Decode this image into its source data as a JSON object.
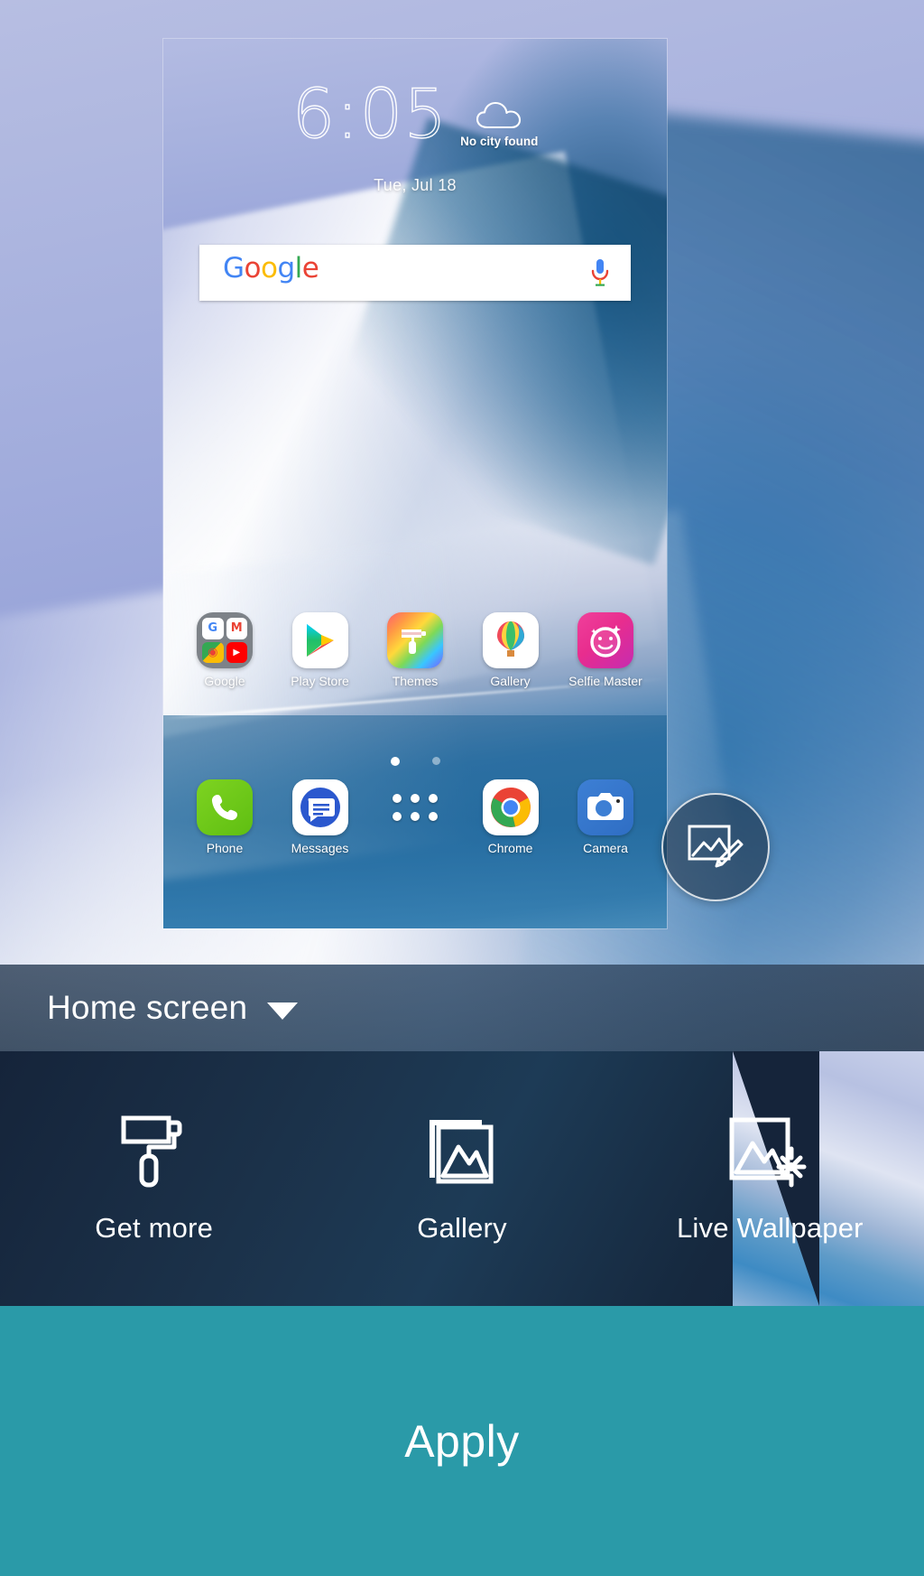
{
  "preview": {
    "clock": {
      "time": "6:05",
      "date": "Tue, Jul 18",
      "weather_city": "No city found",
      "weather_icon": "cloud-icon"
    },
    "search": {
      "logo_letters": [
        "G",
        "o",
        "o",
        "g",
        "l",
        "e"
      ],
      "mic_icon": "microphone-icon"
    },
    "apps_row1": [
      {
        "label": "Google",
        "icon": "google-folder-icon",
        "sub_icons": [
          "google-g-icon",
          "gmail-icon",
          "maps-icon",
          "youtube-icon"
        ]
      },
      {
        "label": "Play Store",
        "icon": "play-store-icon"
      },
      {
        "label": "Themes",
        "icon": "themes-paint-roller-icon"
      },
      {
        "label": "Gallery",
        "icon": "gallery-balloon-icon"
      },
      {
        "label": "Selfie Master",
        "icon": "selfie-master-icon"
      }
    ],
    "page_indicator": {
      "count": 2,
      "active_index": 0
    },
    "dock": [
      {
        "label": "Phone",
        "icon": "phone-handset-icon"
      },
      {
        "label": "Messages",
        "icon": "messages-bubble-icon"
      },
      {
        "label": "",
        "icon": "app-drawer-grid-icon"
      },
      {
        "label": "Chrome",
        "icon": "chrome-icon"
      },
      {
        "label": "Camera",
        "icon": "camera-icon"
      }
    ],
    "fab": {
      "icon": "edit-image-icon",
      "label": ""
    }
  },
  "mode_selector": {
    "label": "Home screen",
    "caret_icon": "chevron-down-icon"
  },
  "options": [
    {
      "label": "Get more",
      "icon": "paint-roller-icon"
    },
    {
      "label": "Gallery",
      "icon": "gallery-image-icon"
    },
    {
      "label": "Live Wallpaper",
      "icon": "live-wallpaper-icon"
    }
  ],
  "apply": {
    "label": "Apply"
  },
  "colors": {
    "apply_bg": "#2a9aa8",
    "panel_bg": "#15243a",
    "mode_bar_bg": "#293c54",
    "accent_white": "#ffffff"
  }
}
